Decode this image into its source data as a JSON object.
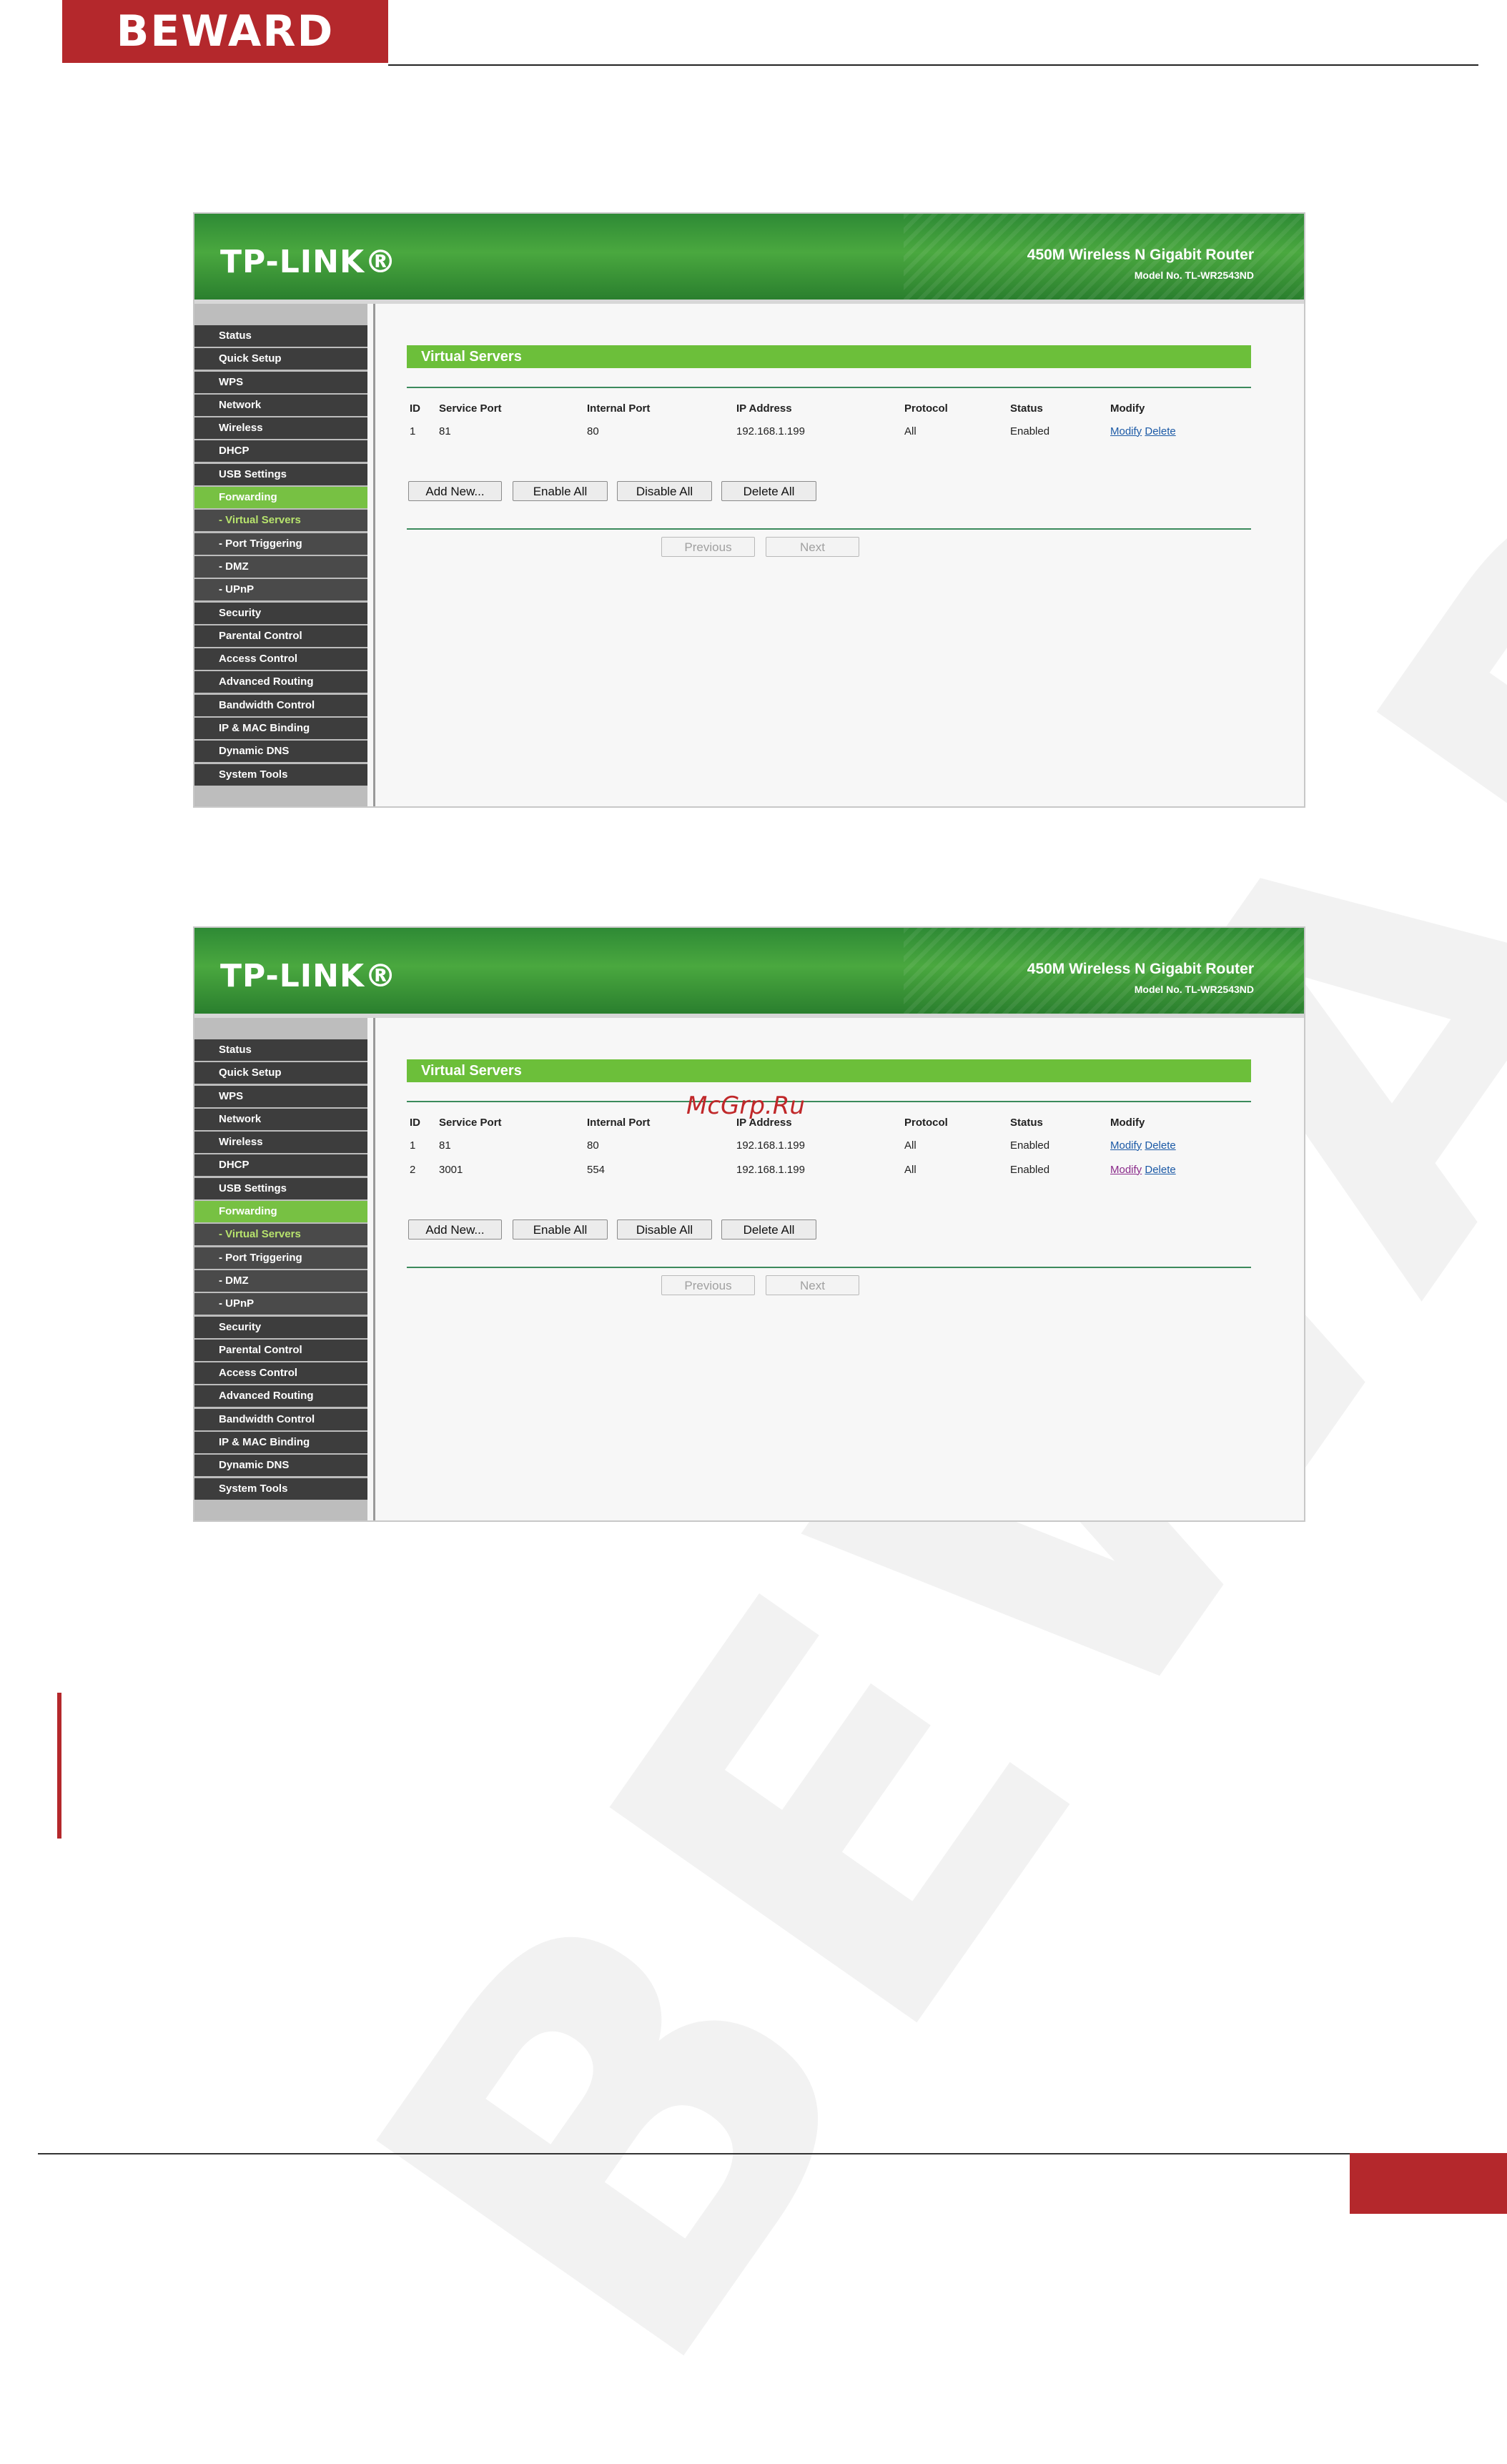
{
  "document": {
    "brand": "BEWARD",
    "watermark": "BEWARD",
    "site": "McGrp.Ru"
  },
  "router": {
    "logo": "TP-LINK®",
    "product_title": "450M Wireless N Gigabit Router",
    "model": "Model No. TL-WR2543ND",
    "menu": [
      {
        "label": "Status"
      },
      {
        "label": "Quick Setup"
      },
      {
        "label": "WPS"
      },
      {
        "label": "Network"
      },
      {
        "label": "Wireless"
      },
      {
        "label": "DHCP"
      },
      {
        "label": "USB Settings"
      },
      {
        "label": "Forwarding"
      },
      {
        "label": "- Virtual Servers"
      },
      {
        "label": "- Port Triggering"
      },
      {
        "label": "- DMZ"
      },
      {
        "label": "- UPnP"
      },
      {
        "label": "Security"
      },
      {
        "label": "Parental Control"
      },
      {
        "label": "Access Control"
      },
      {
        "label": "Advanced Routing"
      },
      {
        "label": "Bandwidth Control"
      },
      {
        "label": "IP & MAC Binding"
      },
      {
        "label": "Dynamic DNS"
      },
      {
        "label": "System Tools"
      }
    ],
    "active_menu": "Forwarding",
    "selected_submenu": "- Virtual Servers",
    "section_title": "Virtual Servers",
    "table_headers": [
      "ID",
      "Service Port",
      "Internal Port",
      "IP Address",
      "Protocol",
      "Status",
      "Modify"
    ],
    "modify_label": "Modify",
    "delete_label": "Delete",
    "buttons": {
      "add_new": "Add New...",
      "enable_all": "Enable All",
      "disable_all": "Disable All",
      "delete_all": "Delete All",
      "previous": "Previous",
      "next": "Next"
    }
  },
  "screenshot1": {
    "rows": [
      {
        "id": "1",
        "service_port": "81",
        "internal_port": "80",
        "ip": "192.168.1.199",
        "protocol": "All",
        "status": "Enabled"
      }
    ]
  },
  "screenshot2": {
    "rows": [
      {
        "id": "1",
        "service_port": "81",
        "internal_port": "80",
        "ip": "192.168.1.199",
        "protocol": "All",
        "status": "Enabled"
      },
      {
        "id": "2",
        "service_port": "3001",
        "internal_port": "554",
        "ip": "192.168.1.199",
        "protocol": "All",
        "status": "Enabled"
      }
    ]
  },
  "colors": {
    "brand_red": "#b4282c",
    "router_green": "#4aa83f",
    "menu_active": "#77c143",
    "link_blue": "#1c5aa6"
  }
}
